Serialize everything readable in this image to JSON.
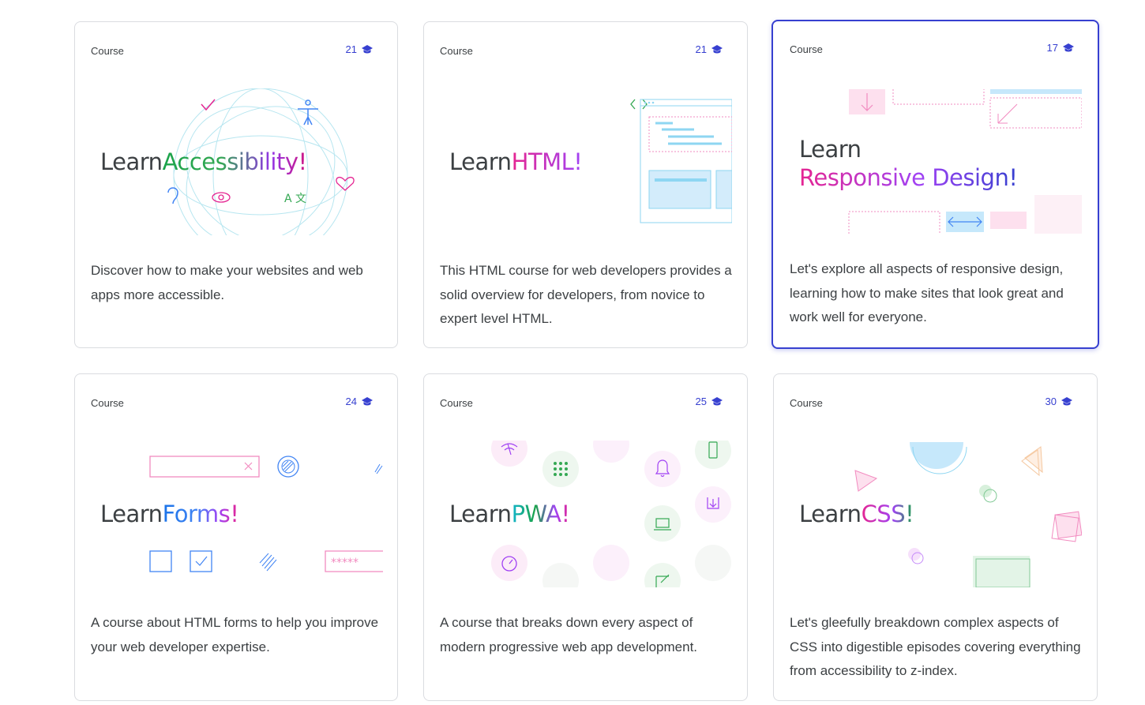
{
  "cards": [
    {
      "label": "Course",
      "count": "21",
      "title_learn": "Learn",
      "title_topic": "Accessibility!",
      "description": "Discover how to make your websites and web apps more accessible."
    },
    {
      "label": "Course",
      "count": "21",
      "title_learn": "Learn",
      "title_topic": "HTML!",
      "description": "This HTML course for web developers provides a solid overview for developers, from novice to expert level HTML."
    },
    {
      "label": "Course",
      "count": "17",
      "title_learn": "Learn",
      "title_topic": "Responsive Design!",
      "description": "Let's explore all aspects of responsive design, learning how to make sites that look great and work well for everyone."
    },
    {
      "label": "Course",
      "count": "24",
      "title_learn": "Learn",
      "title_topic": "Forms!",
      "description": "A course about HTML forms to help you improve your web developer expertise."
    },
    {
      "label": "Course",
      "count": "25",
      "title_learn": "Learn",
      "title_topic": "PWA!",
      "description": "A course that breaks down every aspect of modern progressive web app development."
    },
    {
      "label": "Course",
      "count": "30",
      "title_learn": "Learn",
      "title_topic": "CSS!",
      "description": "Let's gleefully breakdown complex aspects of CSS into digestible episodes covering everything from accessibility to z-index."
    }
  ],
  "colors": {
    "accent": "#3740d0",
    "border": "#dadce0",
    "text": "#3c4043"
  },
  "icons": {
    "count_icon": "graduation-cap-icon"
  }
}
